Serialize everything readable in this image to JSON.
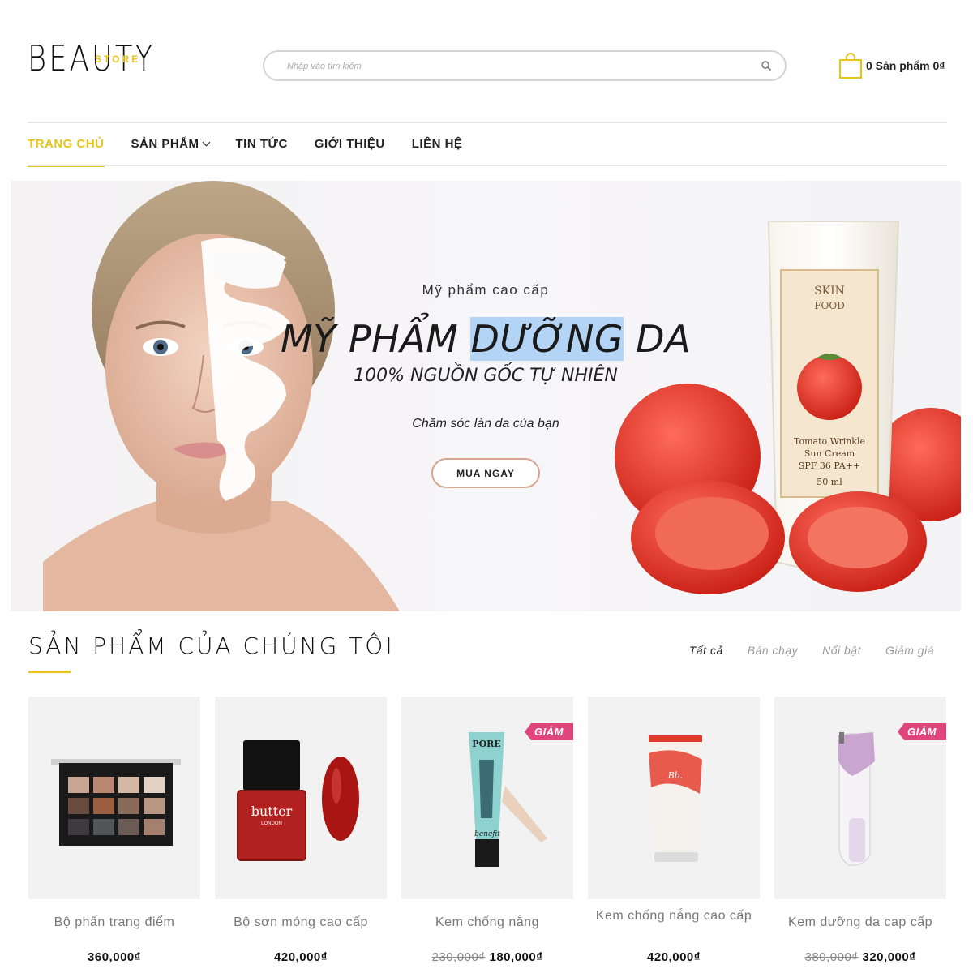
{
  "header": {
    "logo_main": "BEAUTY",
    "logo_sub": "STORE",
    "search_placeholder": "Nhập vào tìm kiếm",
    "cart_label": "0 Sản phẩm 0₫"
  },
  "nav": {
    "items": [
      {
        "label": "TRANG CHỦ",
        "active": true
      },
      {
        "label": "SẢN PHẨM",
        "has_dropdown": true
      },
      {
        "label": "TIN TỨC"
      },
      {
        "label": "GIỚI THIỆU"
      },
      {
        "label": "LIÊN HỆ"
      }
    ]
  },
  "banner": {
    "eyebrow": "Mỹ phẩm cao cấp",
    "title_part1": "MỸ PHẨM",
    "title_highlight": "DƯỠNG",
    "title_part2": "DA",
    "subtitle": "100% NGUỒN GỐC TỰ NHIÊN",
    "description": "Chăm sóc làn da của bạn",
    "cta_label": "MUA NGAY",
    "product_label_lines": [
      "SKIN",
      "FOOD",
      "Tomato Wrinkle",
      "Sun Cream",
      "SPF 36 PA++",
      "50 ml"
    ]
  },
  "products_section": {
    "title": "SẢN PHẨM CỦA CHÚNG TÔI",
    "tabs": [
      "Tất cả",
      "Bán chạy",
      "Nổi bật",
      "Giảm giá"
    ],
    "active_tab": 0,
    "sale_badge": "GIẢM",
    "items": [
      {
        "name": "Bộ phấn trang điểm",
        "price": "360,000₫",
        "old_price": null,
        "sale": false,
        "icon": "eyeshadow-palette-image"
      },
      {
        "name": "Bộ sơn móng cao cấp",
        "price": "420,000₫",
        "old_price": null,
        "sale": false,
        "icon": "nail-polish-image",
        "brand": "butter",
        "brand_sub": "LONDON"
      },
      {
        "name": "Kem chống nắng",
        "price": "180,000₫",
        "old_price": "230,000₫",
        "sale": true,
        "icon": "primer-tube-image",
        "brand": "PORE",
        "brand_sub": "benefit"
      },
      {
        "name": "Kem chống nắng cao cấp",
        "price": "420,000₫",
        "old_price": null,
        "sale": false,
        "icon": "sunscreen-tube-image",
        "brand": "Bb."
      },
      {
        "name": "Kem dưỡng da cap cấp",
        "price": "320,000₫",
        "old_price": "380,000₫",
        "sale": true,
        "icon": "skin-device-image"
      }
    ]
  },
  "colors": {
    "accent": "#e8c419",
    "sale_badge": "#e0457b",
    "cta_border": "#d7a48f",
    "highlight": "#b3d4f5"
  }
}
